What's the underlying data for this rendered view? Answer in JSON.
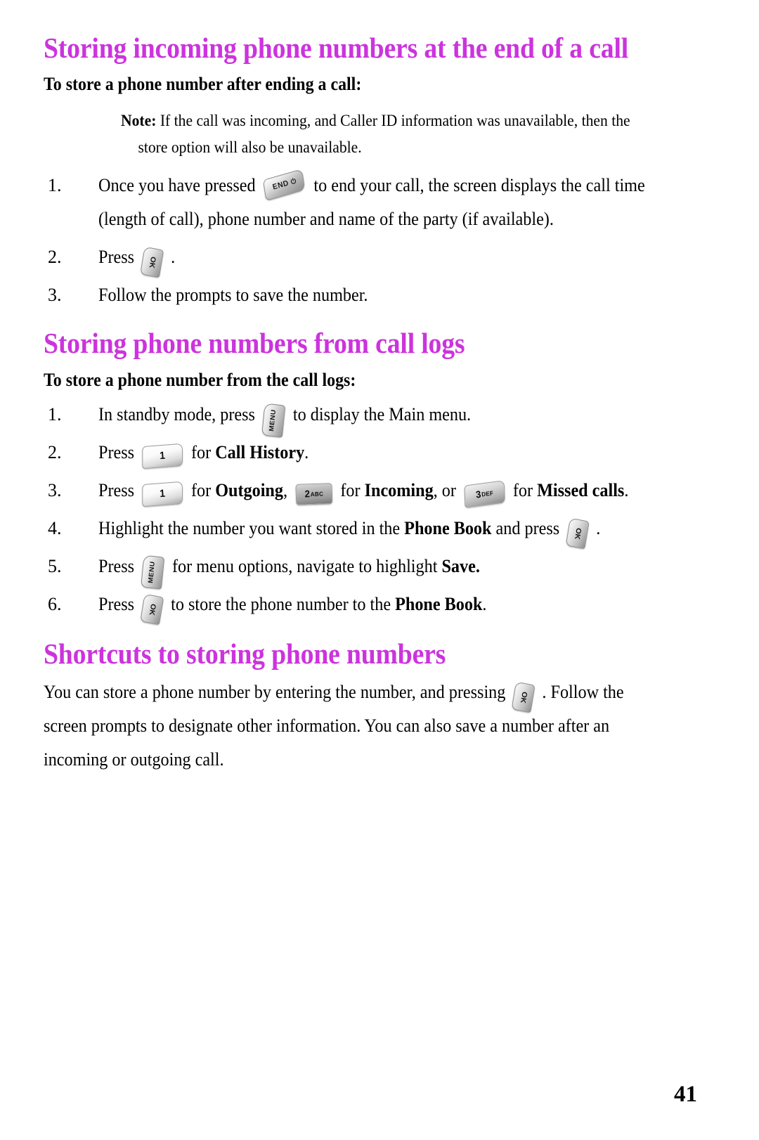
{
  "document": {
    "page_number": "41",
    "heading_color": "#cc33dd"
  },
  "sections": [
    {
      "title": "Storing incoming phone numbers at the end of a call",
      "subtitle": "To store a phone number after ending a call:",
      "note": {
        "label": "Note:",
        "text": "If the call was incoming, and Caller ID information was unavailable, then the store option will also be unavailable."
      },
      "steps": [
        {
          "num": "1.",
          "before": "Once you have pressed",
          "key": "end-key",
          "after": "to end your call, the screen displays the call time (length of call), phone number and name of the party (if available)."
        },
        {
          "num": "2.",
          "before": "Press",
          "key": "ok-key",
          "after": "."
        },
        {
          "num": "3.",
          "before": "Follow the prompts to save the number.",
          "key": "",
          "after": ""
        }
      ]
    },
    {
      "title": "Storing phone numbers from call logs",
      "subtitle": "To store a phone number from the call logs:",
      "steps": [
        {
          "num": "1.",
          "before": "In standby mode, press",
          "key": "menu-key",
          "after": "to display the Main menu."
        },
        {
          "num": "2.",
          "before": "Press",
          "key": "key-1",
          "after_plain": "for",
          "after_bold": "Call History",
          "after_tail": "."
        },
        {
          "num": "3.",
          "before": "Press",
          "key": "key-1",
          "mid_plain_1": "for",
          "mid_bold_1": "Outgoing",
          "mid_comma_1": ",",
          "key2": "key-2",
          "mid_plain_2": "for",
          "mid_bold_2": "Incoming",
          "mid_plain_3": ", or",
          "key3": "key-3",
          "mid_plain_4": "for",
          "mid_bold_3": "Missed calls",
          "tail": "."
        },
        {
          "num": "4.",
          "before": "Highlight the number you want stored in the",
          "bold_1": "Phone Book",
          "after": "and press",
          "key": "ok-key",
          "tail": "."
        },
        {
          "num": "5.",
          "before": "Press",
          "key": "menu-key",
          "after": "for menu options, navigate to highlight",
          "bold_1": "Save.",
          "tail": ""
        },
        {
          "num": "6.",
          "before": "Press",
          "key": "ok-key",
          "after": "to store the phone number to the",
          "bold_1": "Phone Book",
          "tail": "."
        }
      ]
    },
    {
      "title": "Shortcuts to storing phone numbers",
      "paragraph": {
        "part_1": "You can store a phone number by entering the number, and pressing",
        "key": "ok-key",
        "part_2": ". Follow the screen prompts to designate other information. You can also save a number after an incoming or outgoing call."
      }
    }
  ],
  "keys": {
    "end": {
      "label": "END",
      "glyph": "⏻",
      "name": "end-key"
    },
    "ok": {
      "label": "OK",
      "name": "ok-key"
    },
    "menu": {
      "label": "MENU",
      "name": "menu-key"
    },
    "one": {
      "digit": "1",
      "letters": "",
      "name": "key-1"
    },
    "two": {
      "digit": "2",
      "letters": "ABC",
      "name": "key-2"
    },
    "three": {
      "digit": "3",
      "letters": "DEF",
      "name": "key-3"
    }
  }
}
